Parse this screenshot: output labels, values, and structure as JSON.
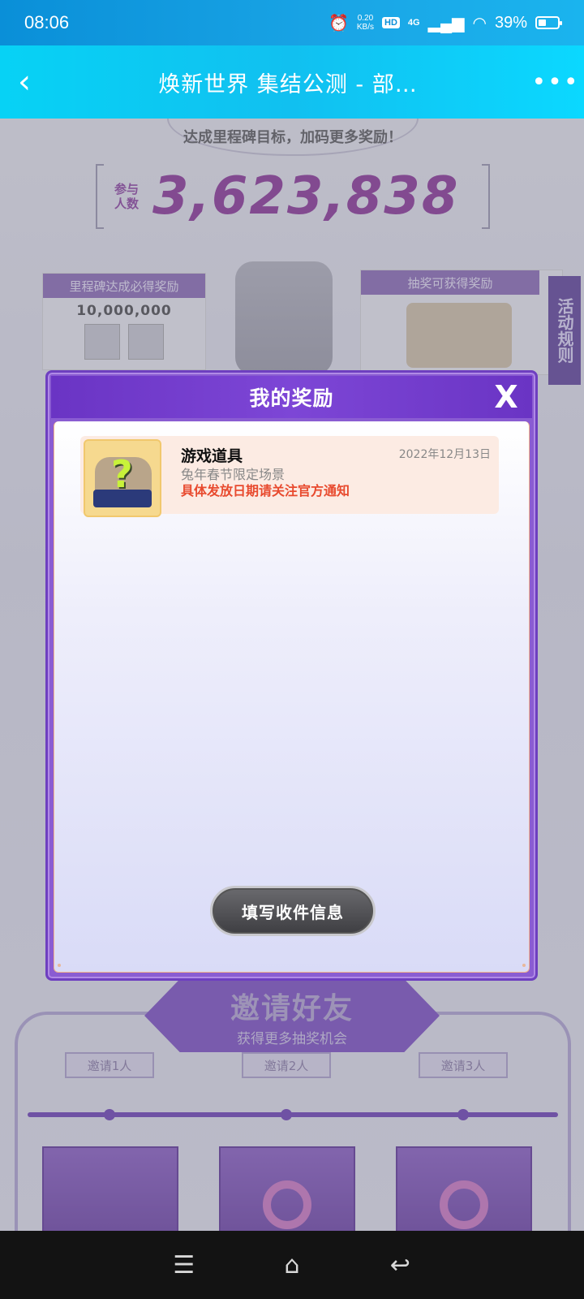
{
  "status_bar": {
    "time": "08:06",
    "net_speed_value": "0.20",
    "net_speed_unit": "KB/s",
    "hd": "HD",
    "network": "4G",
    "battery": "39%",
    "battery_level": 0.39
  },
  "nav": {
    "title": "焕新世界 集结公测 - 部…",
    "back_icon": "chevron-left-icon",
    "more_icon": "more-horizontal-icon"
  },
  "background": {
    "milestone_text": "达成里程碑目标，加码更多奖励！",
    "participants_label_1": "参与",
    "participants_label_2": "人数",
    "participants_count": "3,623,838",
    "milestone_card_title": "里程碑达成必得奖励",
    "milestone_card_number": "10,000,000",
    "lottery_card_title": "抽奖可获得奖励",
    "activity_rules": "活动规则",
    "invite_title": "邀请好友",
    "invite_subtitle": "获得更多抽奖机会",
    "invite_steps": [
      "邀请1人",
      "邀请2人",
      "邀请3人"
    ]
  },
  "modal": {
    "title": "我的奖励",
    "close_label": "X",
    "rewards": [
      {
        "name": "游戏道具",
        "subtitle": "兔年春节限定场景",
        "note": "具体发放日期请关注官方通知",
        "date": "2022年12月13日"
      }
    ],
    "fill_button": "填写收件信息"
  },
  "system_nav": {
    "menu_icon": "menu-icon",
    "home_icon": "home-icon",
    "back_icon": "back-icon"
  },
  "colors": {
    "nav_bar": "#11c0f0",
    "modal_header": "#7d46d6",
    "note_red": "#e84a2e"
  }
}
